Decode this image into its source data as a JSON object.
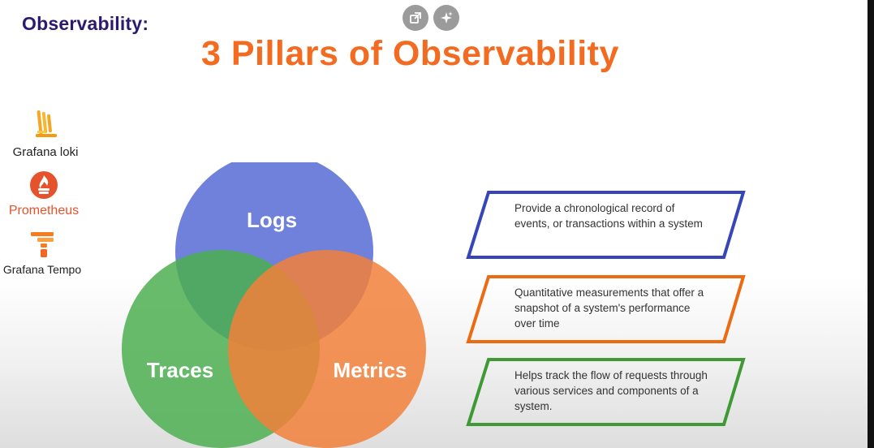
{
  "heading": "Observability:",
  "title": "3 Pillars of Observability",
  "toolbar": {
    "icons": [
      "open-external-icon",
      "sparkle-icon"
    ]
  },
  "logos": [
    {
      "name": "Grafana loki",
      "color": "#f5a623"
    },
    {
      "name": "Prometheus",
      "color": "#e6522c"
    },
    {
      "name": "Grafana Tempo",
      "color": "#f57c1f"
    }
  ],
  "venn": {
    "circles": [
      {
        "label": "Logs",
        "color": "#5b6fd6"
      },
      {
        "label": "Traces",
        "color": "#4caf50"
      },
      {
        "label": "Metrics",
        "color": "#f2803a"
      }
    ]
  },
  "descriptions": [
    {
      "text": "Provide a chronological record of events, or transactions within a system",
      "border": "#3646b8"
    },
    {
      "text": "Quantitative measurements that offer a snapshot of a system's performance over time",
      "border": "#ec6a12"
    },
    {
      "text": "Helps track the flow of requests through various services and components of a system.",
      "border": "#3f9a36"
    }
  ]
}
